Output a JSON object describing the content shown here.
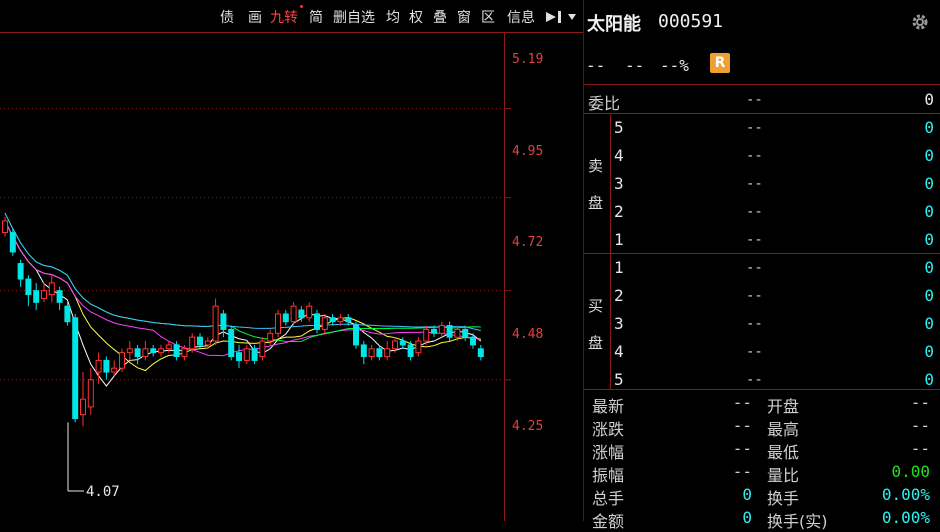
{
  "toolbar": {
    "items": [
      "债",
      "画",
      "九转",
      "简",
      "删自选",
      "均",
      "权",
      "叠",
      "窗",
      "区",
      "信息"
    ],
    "active": "九转",
    "arrow_icon": "arrow-right-bar-icon",
    "dropdown_icon": "chevron-down-icon"
  },
  "chart": {
    "price_axis": [
      "5.19",
      "4.95",
      "4.72",
      "4.48",
      "4.25"
    ],
    "low_marker": "4.07",
    "colors": {
      "up": "#ff3232",
      "down": "#00e5e5",
      "grid": "#8a1a1a",
      "ma5": "#ffffff",
      "ma10": "#ffff40",
      "ma20": "#ff40ff",
      "ma30": "#00ff40",
      "ma60": "#40c0ff"
    }
  },
  "quote": {
    "name": "太阳能",
    "code": "000591",
    "price": "--",
    "change": "--",
    "pct": "--%",
    "r_badge": "R",
    "settings_icon": "gear-icon",
    "weibi_label": "委比",
    "weibi_dash": "--",
    "weibi_value": "0",
    "sell_label_1": "卖",
    "sell_label_2": "盘",
    "buy_label_1": "买",
    "buy_label_2": "盘",
    "sell": [
      {
        "level": "5",
        "price": "--",
        "vol": "0"
      },
      {
        "level": "4",
        "price": "--",
        "vol": "0"
      },
      {
        "level": "3",
        "price": "--",
        "vol": "0"
      },
      {
        "level": "2",
        "price": "--",
        "vol": "0"
      },
      {
        "level": "1",
        "price": "--",
        "vol": "0"
      }
    ],
    "buy": [
      {
        "level": "1",
        "price": "--",
        "vol": "0"
      },
      {
        "level": "2",
        "price": "--",
        "vol": "0"
      },
      {
        "level": "3",
        "price": "--",
        "vol": "0"
      },
      {
        "level": "4",
        "price": "--",
        "vol": "0"
      },
      {
        "level": "5",
        "price": "--",
        "vol": "0"
      }
    ],
    "stats": [
      {
        "l1": "最新",
        "v1": "--",
        "l2": "开盘",
        "v2": "--"
      },
      {
        "l1": "涨跌",
        "v1": "--",
        "l2": "最高",
        "v2": "--"
      },
      {
        "l1": "涨幅",
        "v1": "--",
        "l2": "最低",
        "v2": "--"
      },
      {
        "l1": "振幅",
        "v1": "--",
        "l2": "量比",
        "v2": "0.00"
      },
      {
        "l1": "总手",
        "v1": "0",
        "l2": "换手",
        "v2": "0.00%"
      },
      {
        "l1": "金额",
        "v1": "0",
        "l2": "换手(实)",
        "v2": "0.00%"
      }
    ]
  }
}
